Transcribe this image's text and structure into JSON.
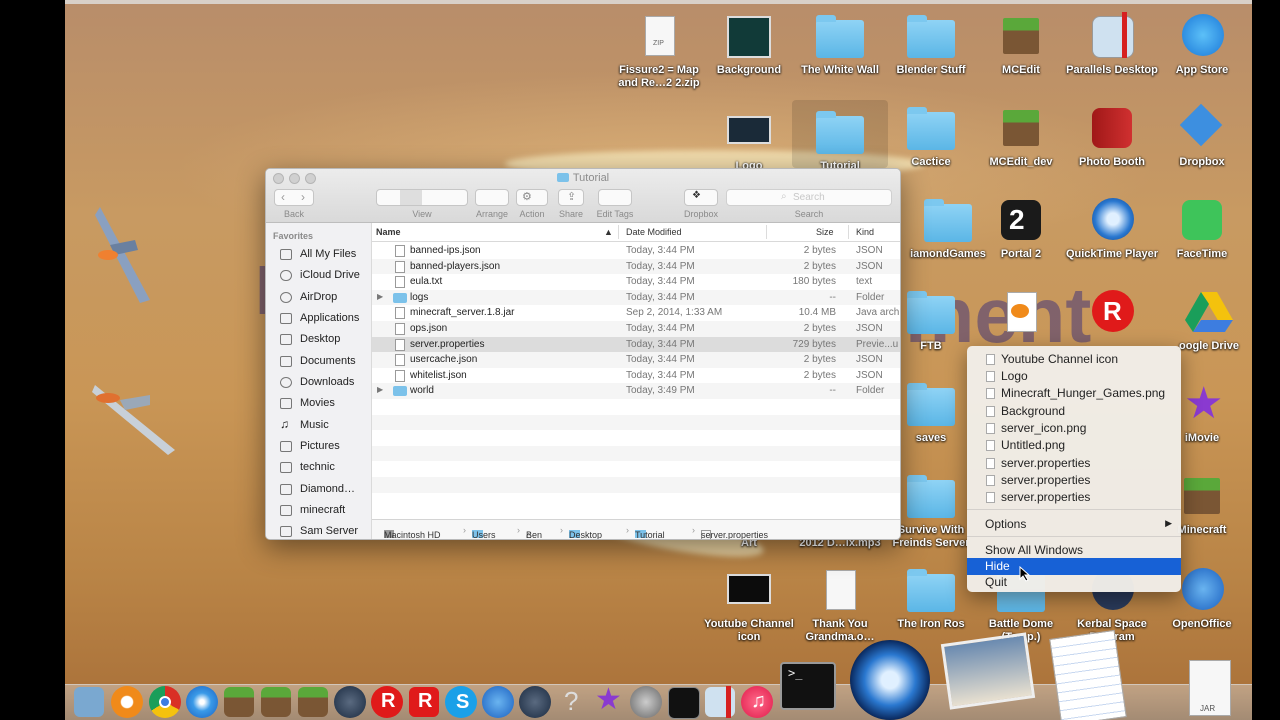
{
  "desktop": {
    "icons": [
      {
        "label": "Fissure2 = Map and Re…2 2.zip"
      },
      {
        "label": "Background"
      },
      {
        "label": "The White Wall"
      },
      {
        "label": "Blender Stuff"
      },
      {
        "label": "MCEdit"
      },
      {
        "label": "Parallels Desktop"
      },
      {
        "label": "App Store"
      },
      {
        "label": "Logo"
      },
      {
        "label": "Tutorial"
      },
      {
        "label": "Cactice"
      },
      {
        "label": "MCEdit_dev"
      },
      {
        "label": "Photo Booth"
      },
      {
        "label": "Dropbox"
      },
      {
        "label": "iamondGames"
      },
      {
        "label": "Portal 2"
      },
      {
        "label": "QuickTime Player"
      },
      {
        "label": "FaceTime"
      },
      {
        "label": "FTB"
      },
      {
        "label": "oogle Drive"
      },
      {
        "label": "saves"
      },
      {
        "label": "iMovie"
      },
      {
        "label": "Youtube Channel Art"
      },
      {
        "label": "CY Chamsdrix 2012 D…ix.mp3"
      },
      {
        "label": "Survive With Freinds Server"
      },
      {
        "label": "Minecraft"
      },
      {
        "label": "Youtube Channel icon"
      },
      {
        "label": "Thank You Grandma.o…"
      },
      {
        "label": "The Iron Ros"
      },
      {
        "label": "Battle Dome (Temp.)"
      },
      {
        "label": "Kerbal Space Program"
      },
      {
        "label": "OpenOffice"
      }
    ],
    "background_text": "ment",
    "background_text_left": "I"
  },
  "finder": {
    "title": "Tutorial",
    "toolbar": {
      "back": "Back",
      "view": "View",
      "arrange": "Arrange",
      "action": "Action",
      "share": "Share",
      "edit_tags": "Edit Tags",
      "dropbox": "Dropbox",
      "search_label": "Search",
      "search_placeholder": "Search"
    },
    "sidebar": {
      "heading": "Favorites",
      "items": [
        {
          "label": "All My Files"
        },
        {
          "label": "iCloud Drive"
        },
        {
          "label": "AirDrop"
        },
        {
          "label": "Applications"
        },
        {
          "label": "Desktop"
        },
        {
          "label": "Documents"
        },
        {
          "label": "Downloads"
        },
        {
          "label": "Movies"
        },
        {
          "label": "Music"
        },
        {
          "label": "Pictures"
        },
        {
          "label": "technic"
        },
        {
          "label": "Diamond…"
        },
        {
          "label": "minecraft"
        },
        {
          "label": "Sam Server"
        }
      ]
    },
    "columns": {
      "name": "Name",
      "date": "Date Modified",
      "size": "Size",
      "kind": "Kind"
    },
    "files": [
      {
        "name": "banned-ips.json",
        "date": "Today, 3:44 PM",
        "size": "2 bytes",
        "kind": "JSON"
      },
      {
        "name": "banned-players.json",
        "date": "Today, 3:44 PM",
        "size": "2 bytes",
        "kind": "JSON"
      },
      {
        "name": "eula.txt",
        "date": "Today, 3:44 PM",
        "size": "180 bytes",
        "kind": "text"
      },
      {
        "name": "logs",
        "date": "Today, 3:44 PM",
        "size": "--",
        "kind": "Folder"
      },
      {
        "name": "minecraft_server.1.8.jar",
        "date": "Sep 2, 2014, 1:33 AM",
        "size": "10.4 MB",
        "kind": "Java arch"
      },
      {
        "name": "ops.json",
        "date": "Today, 3:44 PM",
        "size": "2 bytes",
        "kind": "JSON"
      },
      {
        "name": "server.properties",
        "date": "Today, 3:44 PM",
        "size": "729 bytes",
        "kind": "Previe...u"
      },
      {
        "name": "usercache.json",
        "date": "Today, 3:44 PM",
        "size": "2 bytes",
        "kind": "JSON"
      },
      {
        "name": "whitelist.json",
        "date": "Today, 3:44 PM",
        "size": "2 bytes",
        "kind": "JSON"
      },
      {
        "name": "world",
        "date": "Today, 3:49 PM",
        "size": "--",
        "kind": "Folder"
      }
    ],
    "path": [
      "Macintosh HD",
      "Users",
      "Ben",
      "Desktop",
      "Tutorial",
      "server.properties"
    ]
  },
  "context_menu": {
    "documents": [
      "Youtube Channel icon",
      "Logo",
      "Minecraft_Hunger_Games.png",
      "Background",
      "server_icon.png",
      "Untitled.png",
      "server.properties",
      "server.properties",
      "server.properties"
    ],
    "options": "Options",
    "show_all": "Show All Windows",
    "hide": "Hide",
    "quit": "Quit"
  },
  "dock": {
    "jar_label": "JAR",
    "items": [
      "Preview",
      "Blender",
      "Chrome",
      "Safari",
      "Minecraft",
      "MCEdit",
      "MCEdit_dev",
      "Steam",
      "Roblox",
      "Roblox Studio",
      "Skype",
      "OpenOffice",
      "Steam",
      "Help",
      "iMovie",
      "System Preferences",
      "Activity Monitor",
      "Parallels",
      "iTunes",
      "Terminal",
      "QuickTime Player",
      "Preview",
      "TextEdit",
      "JAR"
    ]
  },
  "colors": {
    "highlight": "#1761d6",
    "folder": "#7cc2ea"
  }
}
